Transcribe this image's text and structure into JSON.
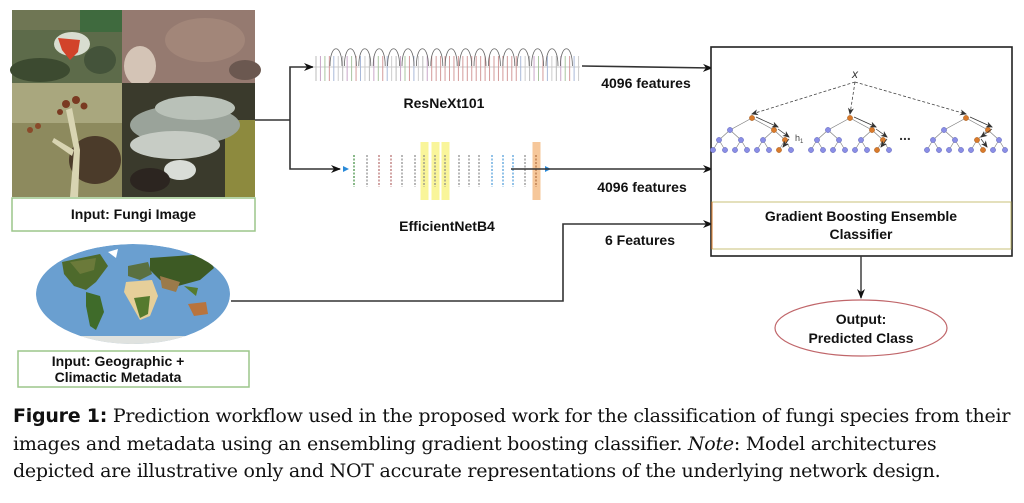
{
  "figure": {
    "inputs": {
      "image_label": "Input: Fungi Image",
      "metadata_label_line1": "Input: Geographic +",
      "metadata_label_line2": "Climactic Metadata"
    },
    "models": {
      "resnext": "ResNeXt101",
      "efficientnet": "EfficientNetB4"
    },
    "edges": {
      "resnext_features": "4096 features",
      "efficientnet_features": "4096 features",
      "metadata_features": "6 Features"
    },
    "classifier": {
      "input_symbol": "x",
      "ellipsis": "...",
      "tree_label": "h",
      "tree_label_sub": "1",
      "title_line1": "Gradient Boosting Ensemble",
      "title_line2": "Classifier"
    },
    "output": {
      "line1": "Output:",
      "line2": "Predicted Class"
    },
    "colors": {
      "input_border": "#9cc68a",
      "classifier_band_border": "#c9c27a",
      "output_ellipse": "#c0666a",
      "tree_node": "#8a8ee6",
      "tree_path_node": "#d97a2b",
      "eff_yellow": "#f9f59a",
      "eff_orange": "#f6c79a",
      "ocean": "#6a9fd0"
    }
  },
  "caption": {
    "label": "Figure 1:",
    "text_part1": " Prediction workflow used in the proposed work for the classification of fungi species from their images and metadata using an ensembling gradient boosting classifier. ",
    "note_label": "Note",
    "text_part2": ": Model architectures depicted are illustrative only and NOT accurate representations of the underlying network design."
  }
}
